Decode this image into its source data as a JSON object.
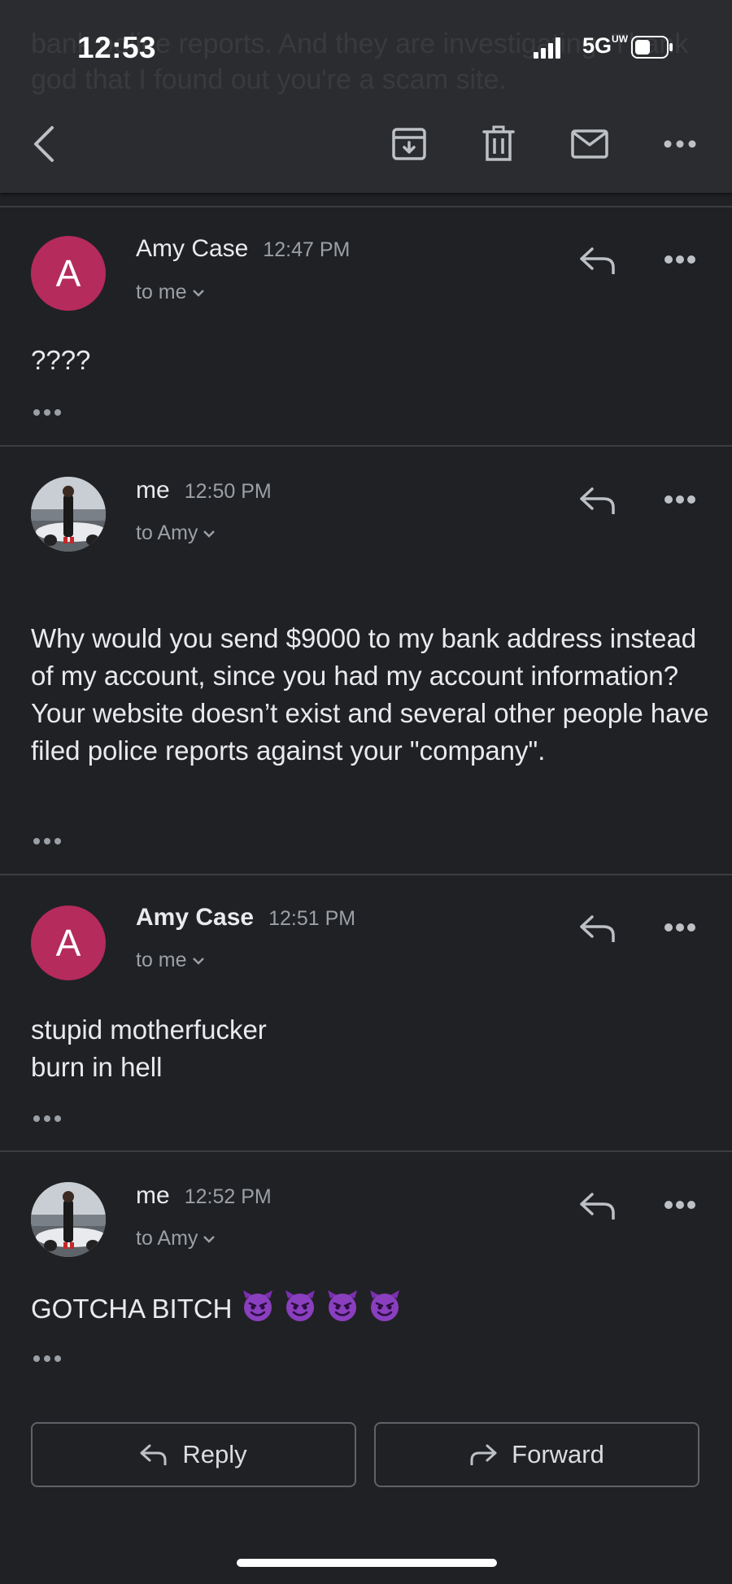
{
  "status_bar": {
    "time": "12:53",
    "network": "5G",
    "network_sup": "UW"
  },
  "header": {
    "ghost_text": "bank police reports. And they are investigating. Thank god that I found out you're a scam site."
  },
  "messages": [
    {
      "sender": "Amy Case",
      "time": "12:47 PM",
      "recipient": "to me",
      "avatar_letter": "A",
      "body": [
        "????"
      ]
    },
    {
      "sender": "me",
      "time": "12:50 PM",
      "recipient": "to Amy",
      "body": [
        "Why would you send $9000 to my bank address instead of my account, since you had my account information? Your website doesn’t exist and several other people have filed police reports against your \"company\"."
      ]
    },
    {
      "sender": "Amy Case",
      "time": "12:51 PM",
      "recipient": "to me",
      "avatar_letter": "A",
      "body": [
        "stupid motherfucker",
        "burn in hell"
      ]
    },
    {
      "sender": "me",
      "time": "12:52 PM",
      "recipient": "to Amy",
      "body": [
        "GOTCHA BITCH"
      ]
    }
  ],
  "actions": {
    "reply": "Reply",
    "forward": "Forward"
  },
  "colors": {
    "background": "#202124",
    "toolbar": "#2b2c2f",
    "avatar_letter_bg": "#b52b5b",
    "emoji": "#8a3fbf"
  },
  "icons": [
    "back-icon",
    "archive-icon",
    "trash-icon",
    "mail-icon",
    "more-icon",
    "reply-icon",
    "forward-icon",
    "smiling-imp-emoji"
  ]
}
